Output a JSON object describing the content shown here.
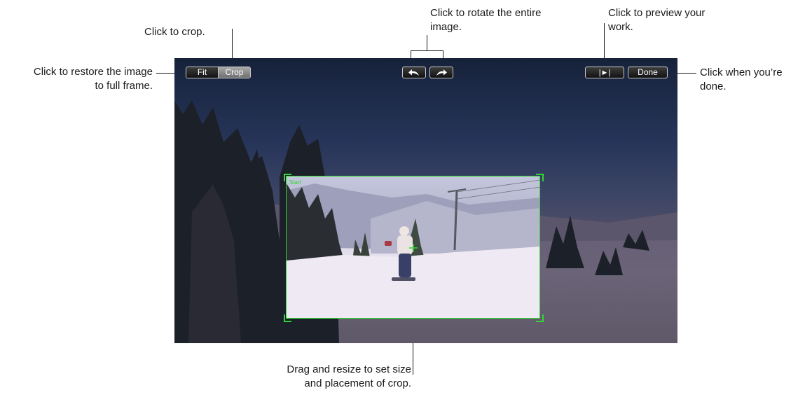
{
  "callouts": {
    "crop": "Click to crop.",
    "rotate_line1": "Click to rotate the entire",
    "rotate_line2": "image.",
    "preview_line1": "Click to preview your",
    "preview_line2": "work.",
    "fit_line1": "Click to restore the image",
    "fit_line2": "to full frame.",
    "done_line1": "Click when you’re",
    "done_line2": "done.",
    "drag_line1": "Drag and resize to set size",
    "drag_line2": "and placement of crop."
  },
  "toolbar": {
    "fit_label": "Fit",
    "crop_label": "Crop",
    "rotate_left_icon": "rotate-left-arrow",
    "rotate_right_icon": "rotate-right-arrow",
    "play_icon": "play-preview",
    "play_glyph": "|►|",
    "done_label": "Done"
  },
  "crop": {
    "start_label": "Start"
  },
  "colors": {
    "crop_outline": "#33d633",
    "button_border": "#c9c9c9",
    "callout_text": "#1a1a1a"
  }
}
